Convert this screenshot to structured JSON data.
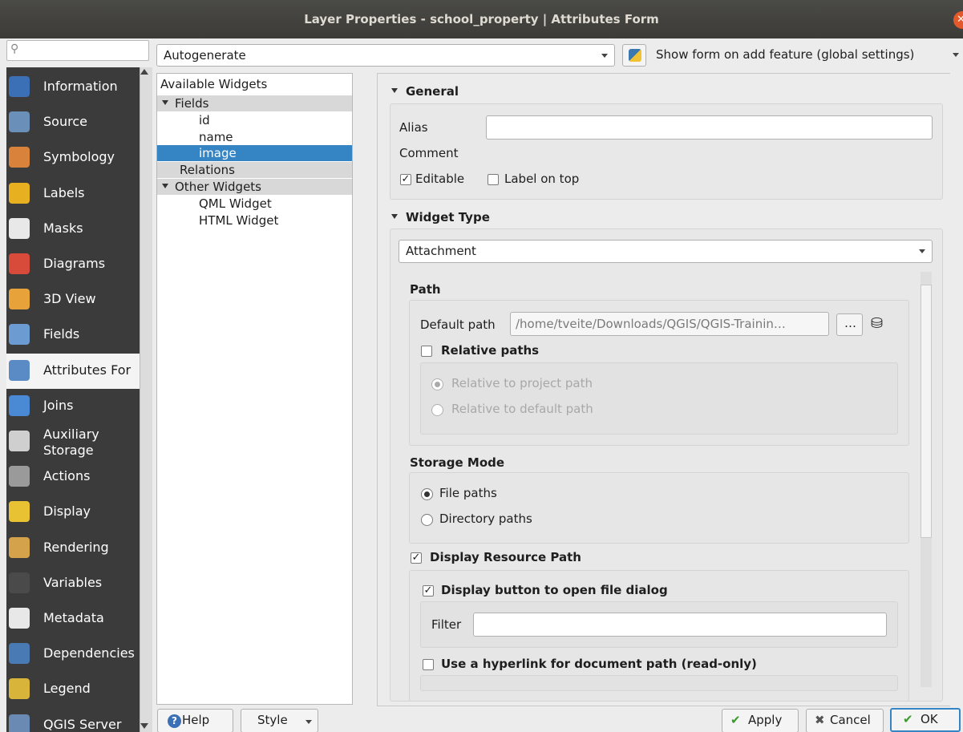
{
  "window": {
    "title": "Layer Properties - school_property | Attributes Form"
  },
  "sidebar": {
    "items": [
      {
        "label": "Information",
        "icon": "information-icon",
        "color": "#3b6fb6"
      },
      {
        "label": "Source",
        "icon": "source-icon",
        "color": "#6a8fb8"
      },
      {
        "label": "Symbology",
        "icon": "symbology-icon",
        "color": "#d9823b"
      },
      {
        "label": "Labels",
        "icon": "labels-icon",
        "color": "#e6b020"
      },
      {
        "label": "Masks",
        "icon": "masks-icon",
        "color": "#e8e8e8"
      },
      {
        "label": "Diagrams",
        "icon": "diagrams-icon",
        "color": "#d84a3a"
      },
      {
        "label": "3D View",
        "icon": "3d-view-icon",
        "color": "#e8a23a"
      },
      {
        "label": "Fields",
        "icon": "fields-icon",
        "color": "#6b9bd1"
      },
      {
        "label": "Attributes For",
        "icon": "attributes-form-icon",
        "color": "#5a8bc4"
      },
      {
        "label": "Joins",
        "icon": "joins-icon",
        "color": "#4a8ad4"
      },
      {
        "label": "Auxiliary",
        "label2": "Storage",
        "icon": "auxiliary-storage-icon",
        "color": "#cfcfcf"
      },
      {
        "label": "Actions",
        "icon": "actions-icon",
        "color": "#9a9a9a"
      },
      {
        "label": "Display",
        "icon": "display-icon",
        "color": "#e9c234"
      },
      {
        "label": "Rendering",
        "icon": "rendering-icon",
        "color": "#d4a24a"
      },
      {
        "label": "Variables",
        "icon": "variables-icon",
        "color": "#4a4a4a"
      },
      {
        "label": "Metadata",
        "icon": "metadata-icon",
        "color": "#e8e8e8"
      },
      {
        "label": "Dependencies",
        "icon": "dependencies-icon",
        "color": "#4a7ab4"
      },
      {
        "label": "Legend",
        "icon": "legend-icon",
        "color": "#d8b43a"
      },
      {
        "label": "QGIS Server",
        "icon": "qgis-server-icon",
        "color": "#6a8ab4"
      }
    ]
  },
  "toolbar": {
    "layout_combo": "Autogenerate",
    "show_form_combo": "Show form on add feature (global settings)"
  },
  "tree": {
    "header": "Available Widgets",
    "fields_label": "Fields",
    "fields": [
      "id",
      "name",
      "image"
    ],
    "relations_label": "Relations",
    "other_label": "Other Widgets",
    "other": [
      "QML Widget",
      "HTML Widget"
    ]
  },
  "general": {
    "title": "General",
    "alias_label": "Alias",
    "alias_value": "",
    "comment_label": "Comment",
    "editable_label": "Editable",
    "editable_checked": "✓",
    "label_on_top": "Label on top"
  },
  "widget_type": {
    "title": "Widget Type",
    "value": "Attachment",
    "path_title": "Path",
    "default_path_label": "Default path",
    "default_path_value": "/home/tveite/Downloads/QGIS/QGIS-Trainin…",
    "browse_label": "…",
    "relative_paths_label": "Relative paths",
    "rel_project": "Relative to project path",
    "rel_default": "Relative to default path",
    "storage_title": "Storage Mode",
    "file_paths": "File paths",
    "dir_paths": "Directory paths",
    "display_resource_label": "Display Resource Path",
    "display_button_label": "Display button to open file dialog",
    "filter_label": "Filter",
    "filter_value": "",
    "hyperlink_label": "Use a hyperlink for document path (read-only)",
    "check_mark": "✓"
  },
  "buttons": {
    "help": "Help",
    "style": "Style",
    "apply": "Apply",
    "cancel": "Cancel",
    "ok": "OK"
  }
}
